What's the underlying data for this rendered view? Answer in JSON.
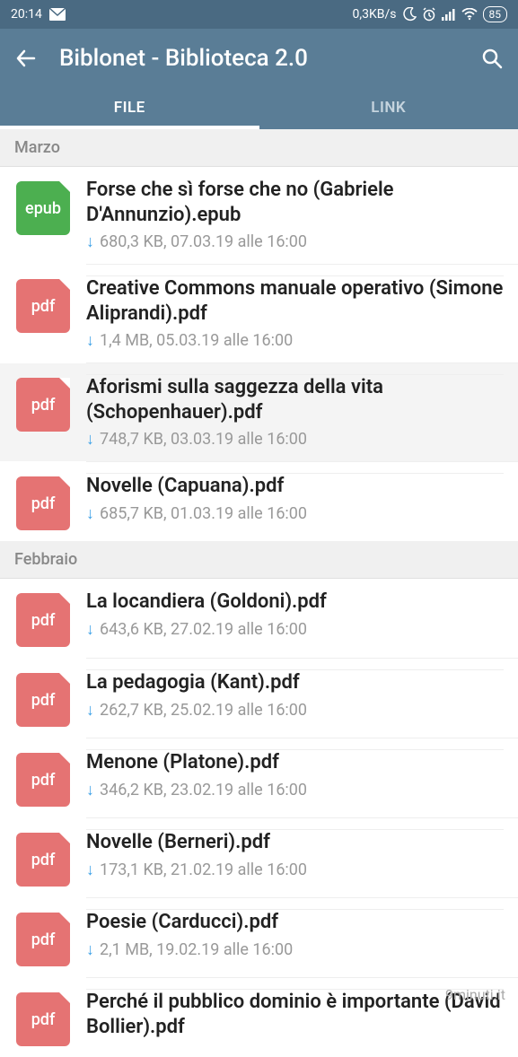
{
  "status": {
    "time": "20:14",
    "net_speed": "0,3KB/s",
    "battery": "85"
  },
  "header": {
    "title": "Biblonet - Biblioteca 2.0"
  },
  "tabs": {
    "file": "FILE",
    "link": "LINK"
  },
  "sections": [
    {
      "label": "Marzo",
      "files": [
        {
          "type": "epub",
          "title": "Forse che sì forse che no (Gabriele D'Annunzio).epub",
          "meta": "680,3 KB, 07.03.19 alle 16:00"
        },
        {
          "type": "pdf",
          "title": "Creative Commons manuale operativo (Simone Aliprandi).pdf",
          "meta": "1,4 MB, 05.03.19 alle 16:00"
        },
        {
          "type": "pdf",
          "title": "Aforismi sulla saggezza della vita (Schopenhauer).pdf",
          "meta": "748,7 KB, 03.03.19 alle 16:00",
          "highlight": true
        },
        {
          "type": "pdf",
          "title": "Novelle (Capuana).pdf",
          "meta": "685,7 KB, 01.03.19 alle 16:00"
        }
      ]
    },
    {
      "label": "Febbraio",
      "files": [
        {
          "type": "pdf",
          "title": "La locandiera (Goldoni).pdf",
          "meta": "643,6 KB, 27.02.19 alle 16:00"
        },
        {
          "type": "pdf",
          "title": "La pedagogia (Kant).pdf",
          "meta": "262,7 KB, 25.02.19 alle 16:00"
        },
        {
          "type": "pdf",
          "title": "Menone (Platone).pdf",
          "meta": "346,2 KB, 23.02.19 alle 16:00"
        },
        {
          "type": "pdf",
          "title": "Novelle (Berneri).pdf",
          "meta": "173,1 KB, 21.02.19 alle 16:00"
        },
        {
          "type": "pdf",
          "title": "Poesie (Carducci).pdf",
          "meta": "2,1 MB, 19.02.19 alle 16:00"
        },
        {
          "type": "pdf",
          "title": "Perché il pubblico dominio è importante (David Bollier).pdf",
          "meta": ""
        }
      ]
    }
  ],
  "watermark": "9minuti.it",
  "icon_labels": {
    "epub": "epub",
    "pdf": "pdf"
  }
}
